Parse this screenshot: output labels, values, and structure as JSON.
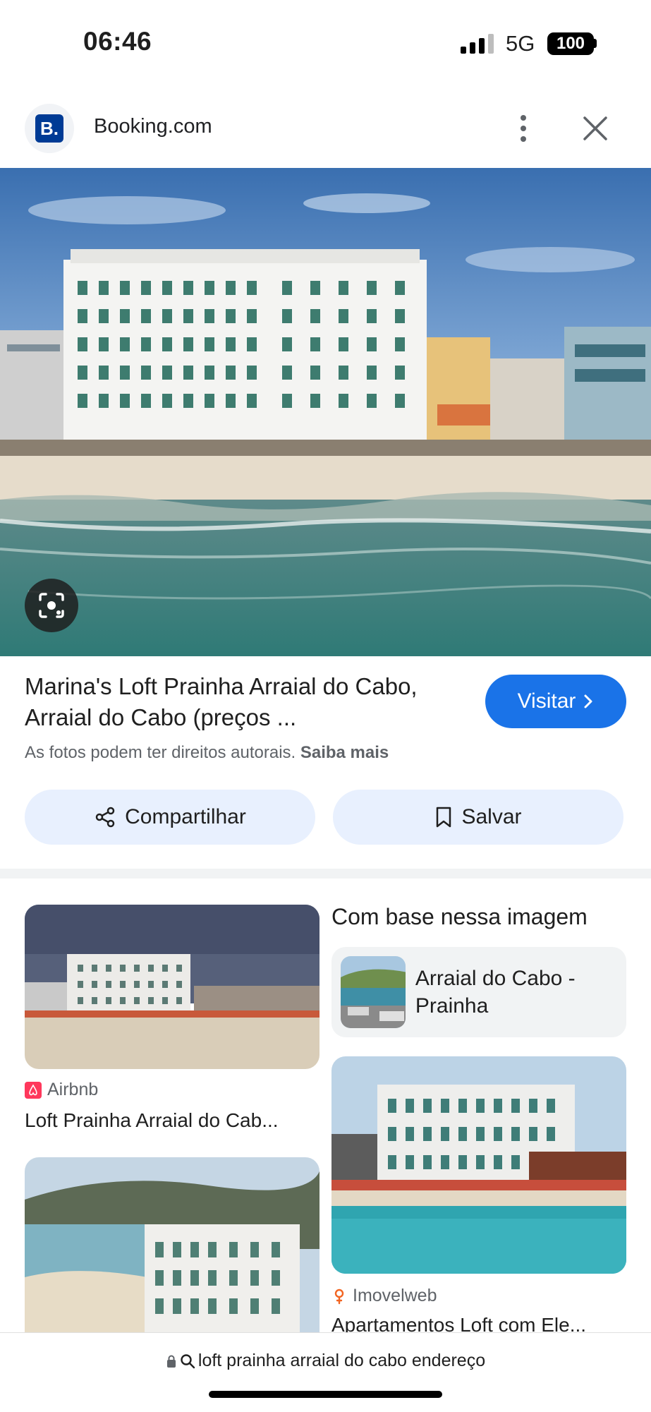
{
  "status_bar": {
    "time": "06:46",
    "network": "5G",
    "battery": "100"
  },
  "header": {
    "site_logo": "B.",
    "site_name": "Booking.com"
  },
  "main": {
    "title": "Marina's Loft Prainha Arraial do Cabo, Arraial do Cabo (preços ...",
    "visit_label": "Visitar",
    "copyright_text": "As fotos podem ter direitos autorais.",
    "learn_more": "Saiba mais",
    "share_label": "Compartilhar",
    "save_label": "Salvar"
  },
  "results": {
    "heading": "Com base nessa imagem",
    "chip_label": "Arraial do Cabo - Prainha",
    "items": [
      {
        "source": "Airbnb",
        "title": "Loft Prainha Arraial do Cab..."
      },
      {
        "source": "Imovelweb",
        "title": "Apartamentos Loft com Ele..."
      }
    ]
  },
  "address_bar": {
    "query": "loft prainha arraial do cabo endereço"
  },
  "colors": {
    "accent": "#1a73e8",
    "pill_bg": "#e8f0fe",
    "booking_blue": "#003b95",
    "airbnb": "#ff385c",
    "imovelweb": "#f26522"
  },
  "icons": [
    "signal-icon",
    "battery-icon",
    "more-vert-icon",
    "close-icon",
    "lens-icon",
    "chevron-right-icon",
    "share-icon",
    "bookmark-icon",
    "lock-icon",
    "search-icon"
  ]
}
